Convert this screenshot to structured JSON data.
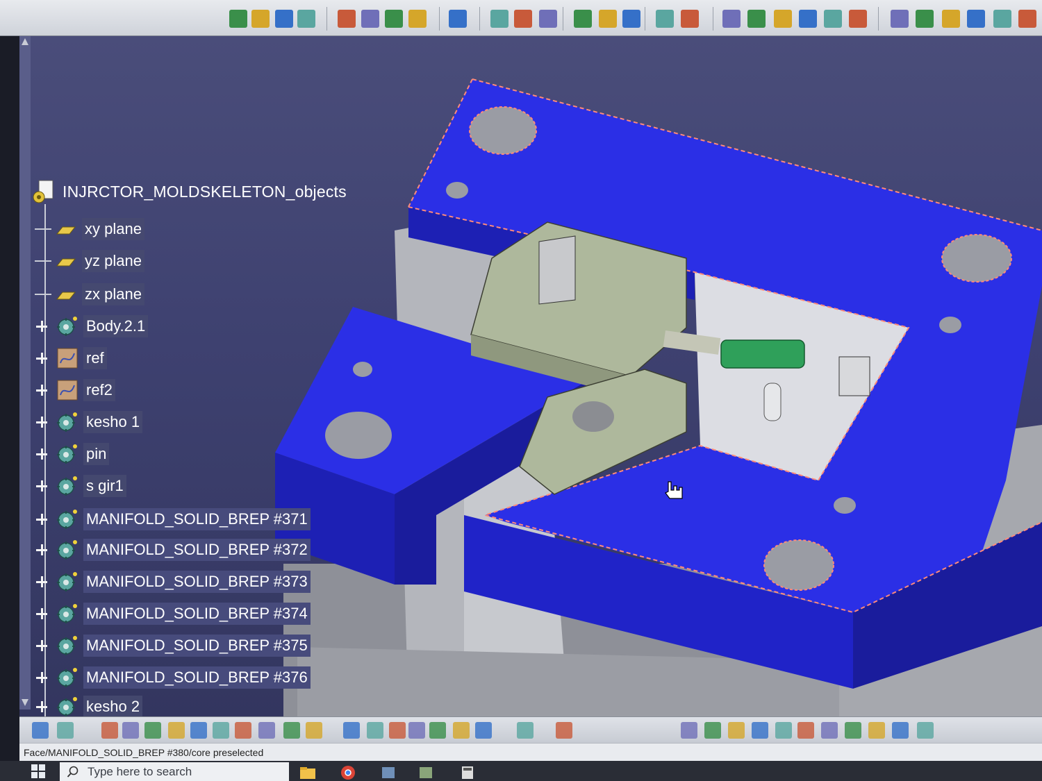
{
  "tree": {
    "root_label": "INJRCTOR_MOLDSKELETON_objects",
    "nodes": [
      {
        "label": "xy plane",
        "kind": "plane"
      },
      {
        "label": "yz plane",
        "kind": "plane"
      },
      {
        "label": "zx plane",
        "kind": "plane"
      },
      {
        "label": "Body.2.1",
        "kind": "body"
      },
      {
        "label": "ref",
        "kind": "geoset"
      },
      {
        "label": "ref2",
        "kind": "geoset"
      },
      {
        "label": "kesho 1",
        "kind": "body"
      },
      {
        "label": "pin",
        "kind": "body"
      },
      {
        "label": "s gir1",
        "kind": "body"
      },
      {
        "label": "MANIFOLD_SOLID_BREP #371",
        "kind": "body"
      },
      {
        "label": "MANIFOLD_SOLID_BREP #372",
        "kind": "body"
      },
      {
        "label": "MANIFOLD_SOLID_BREP #373",
        "kind": "body"
      },
      {
        "label": "MANIFOLD_SOLID_BREP #374",
        "kind": "body"
      },
      {
        "label": "MANIFOLD_SOLID_BREP #375",
        "kind": "body"
      },
      {
        "label": "MANIFOLD_SOLID_BREP #376",
        "kind": "body"
      },
      {
        "label": "kesho 2",
        "kind": "body"
      }
    ]
  },
  "status": {
    "message": "Face/MANIFOLD_SOLID_BREP #380/core preselected"
  },
  "taskbar": {
    "search_placeholder": "Type here to search"
  },
  "colors": {
    "mold_plate": "#2b2fe6",
    "mold_side": "#1b1eb0",
    "core_part": "#aeb89c",
    "grey_block": "#b9bbc0",
    "insert_green": "#2fa05a",
    "selection_edge": "#ff8a7a",
    "viewport_bg": "#3e4170"
  }
}
